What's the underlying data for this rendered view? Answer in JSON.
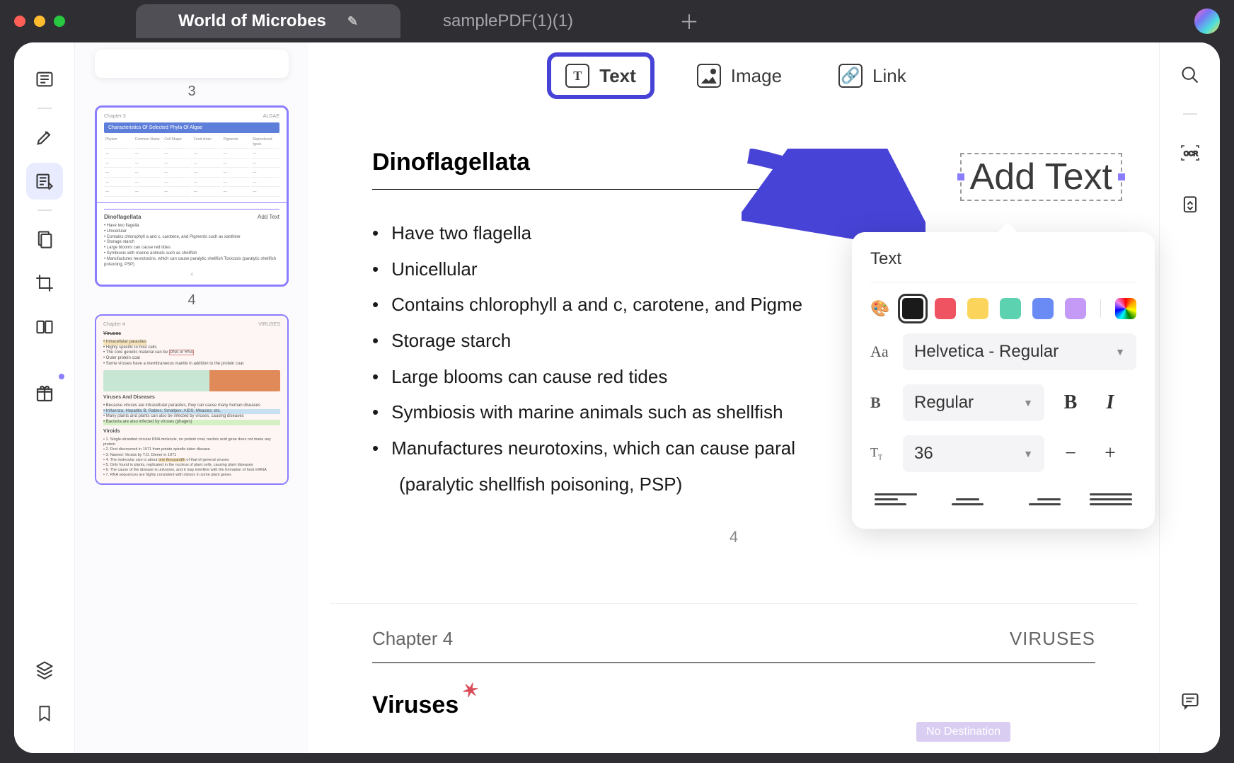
{
  "tabs": {
    "active": "World of Microbes",
    "inactive": "samplePDF(1)(1)"
  },
  "tools": {
    "text": "Text",
    "image": "Image",
    "link": "Link"
  },
  "thumbnails": {
    "label3": "3",
    "label4": "4",
    "p4_chapter": "Chapter 3",
    "p4_chapterTag": "ALGAE",
    "p4_tableTitle": "Characteristics Of Selected Phyla Of Algae",
    "p4_dinoTitle": "Dinoflagellata",
    "p4_addtext": "Add Text",
    "p4_b1": "Have two flagella",
    "p4_b2": "Unicellular",
    "p4_b3": "Contains chlorophyll a and c, carotene, and Pigments such as xanthine",
    "p4_b4": "Storage starch",
    "p4_b5": "Large blooms can cause red tides",
    "p4_b6": "Symbiosis with marine animals such as shellfish",
    "p4_b7": "Manufactures neurotoxins, which can cause paralytic shellfish Toxicosis (paralytic shellfish poisoning, PSP)",
    "p5_chapter": "Chapter 4",
    "p5_chapterTag": "VIRUSES",
    "p5_t1": "Viruses",
    "p5_s1": "Intracellular parasites",
    "p5_t2": "Viruses And Diseases",
    "p5_t3": "Viroids"
  },
  "page": {
    "heading": "Dinoflagellata",
    "addtext": "Add Text",
    "bullets": {
      "b1": "Have two flagella",
      "b2": "Unicellular",
      "b3": "Contains chlorophyll a and c, carotene, and Pigme",
      "b4": "Storage starch",
      "b5": "Large blooms can cause red tides",
      "b6": "Symbiosis with marine animals such as shellfish",
      "b7": "Manufactures neurotoxins, which can cause paral",
      "b7b": "(paralytic shellfish poisoning, PSP)"
    },
    "pageNumber": "4",
    "nextChapter": "Chapter 4",
    "nextTag": "VIRUSES",
    "nextTitle": "Viruses",
    "noDest": "No Destination"
  },
  "textPanel": {
    "title": "Text",
    "colors": {
      "black": "#1a1a1a",
      "red": "#ef5362",
      "yellow": "#fbd55b",
      "teal": "#5cd2b0",
      "blue": "#6a8bf3",
      "purple": "#c49af6"
    },
    "font": "Helvetica - Regular",
    "weight": "Regular",
    "size": "36"
  }
}
